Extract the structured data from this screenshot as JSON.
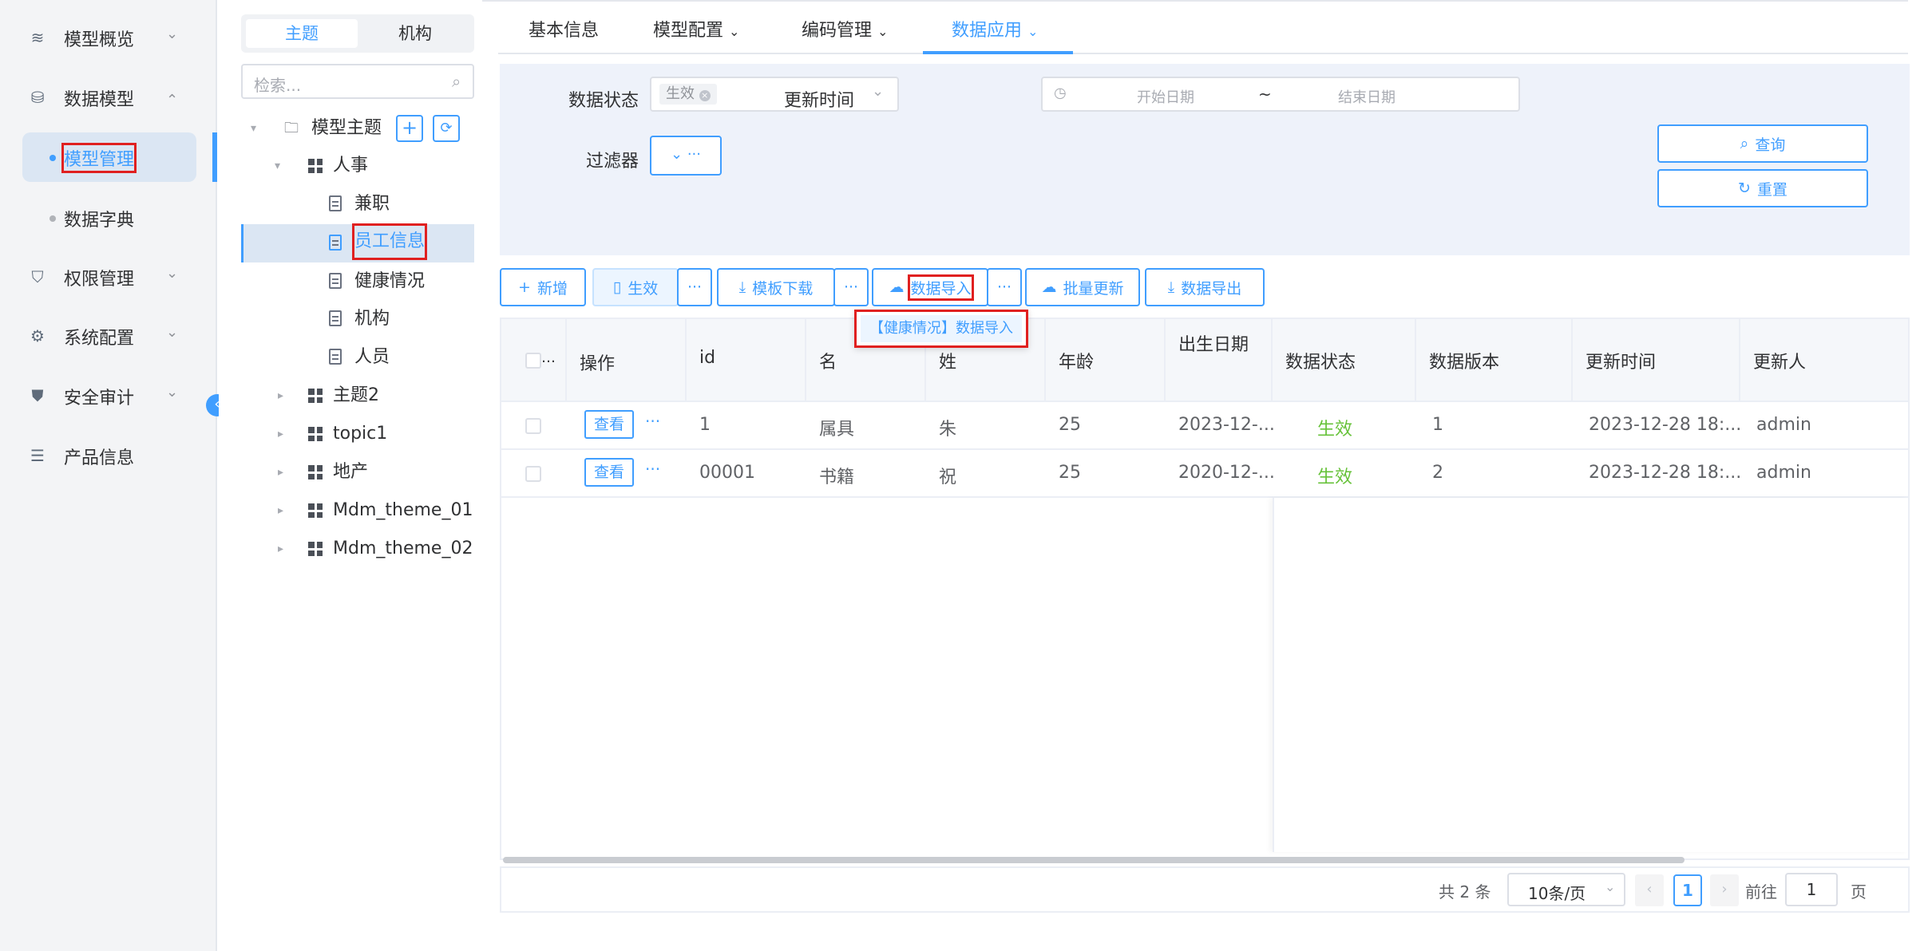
{
  "sidebar": {
    "items": [
      {
        "label": "模型概览",
        "icon": "layers-icon"
      },
      {
        "label": "数据模型",
        "icon": "database-icon"
      },
      {
        "label": "权限管理",
        "icon": "shield-icon"
      },
      {
        "label": "系统配置",
        "icon": "chip-icon"
      },
      {
        "label": "安全审计",
        "icon": "shield-check-icon"
      },
      {
        "label": "产品信息",
        "icon": "file-list-icon"
      }
    ],
    "sub_items": [
      {
        "label": "模型管理"
      },
      {
        "label": "数据字典"
      }
    ]
  },
  "tree": {
    "toggle": [
      "主题",
      "机构"
    ],
    "search_placeholder": "检索...",
    "root": "模型主题",
    "nodes": [
      "人事",
      "兼职",
      "员工信息",
      "健康情况",
      "机构",
      "人员",
      "主题2",
      "topic1",
      "地产",
      "Mdm_theme_01",
      "Mdm_theme_02"
    ]
  },
  "tabs": [
    "基本信息",
    "模型配置",
    "编码管理",
    "数据应用"
  ],
  "filter": {
    "status_label": "数据状态",
    "status_tag": "生效",
    "time_label": "更新时间",
    "start_placeholder": "开始日期",
    "separator": "~",
    "end_placeholder": "结束日期",
    "filter_label": "过滤器",
    "query": "查询",
    "reset": "重置"
  },
  "toolbar": {
    "add": "新增",
    "effective": "生效",
    "template": "模板下载",
    "import": "数据导入",
    "batch": "批量更新",
    "export": "数据导出",
    "import_menu_item": "【健康情况】数据导入"
  },
  "table": {
    "headers": [
      "操作",
      "id",
      "名",
      "姓",
      "年龄",
      "出生日期",
      "数据状态",
      "数据版本",
      "更新时间",
      "更新人"
    ],
    "view_label": "查看",
    "rows": [
      [
        "1",
        "属具",
        "朱",
        "25",
        "2023-12-...",
        "生效",
        "1",
        "2023-12-28 18:...",
        "admin"
      ],
      [
        "00001",
        "书籍",
        "祝",
        "25",
        "2020-12-...",
        "生效",
        "2",
        "2023-12-28 18:...",
        "admin"
      ]
    ]
  },
  "pagination": {
    "total": "共 2 条",
    "size": "10条/页",
    "page": "1",
    "goto_label": "前往",
    "goto_value": "1",
    "page_unit": "页"
  },
  "colors": {
    "accent": "#409eff",
    "status_green": "#67c23a",
    "highlight": "#e02020"
  }
}
